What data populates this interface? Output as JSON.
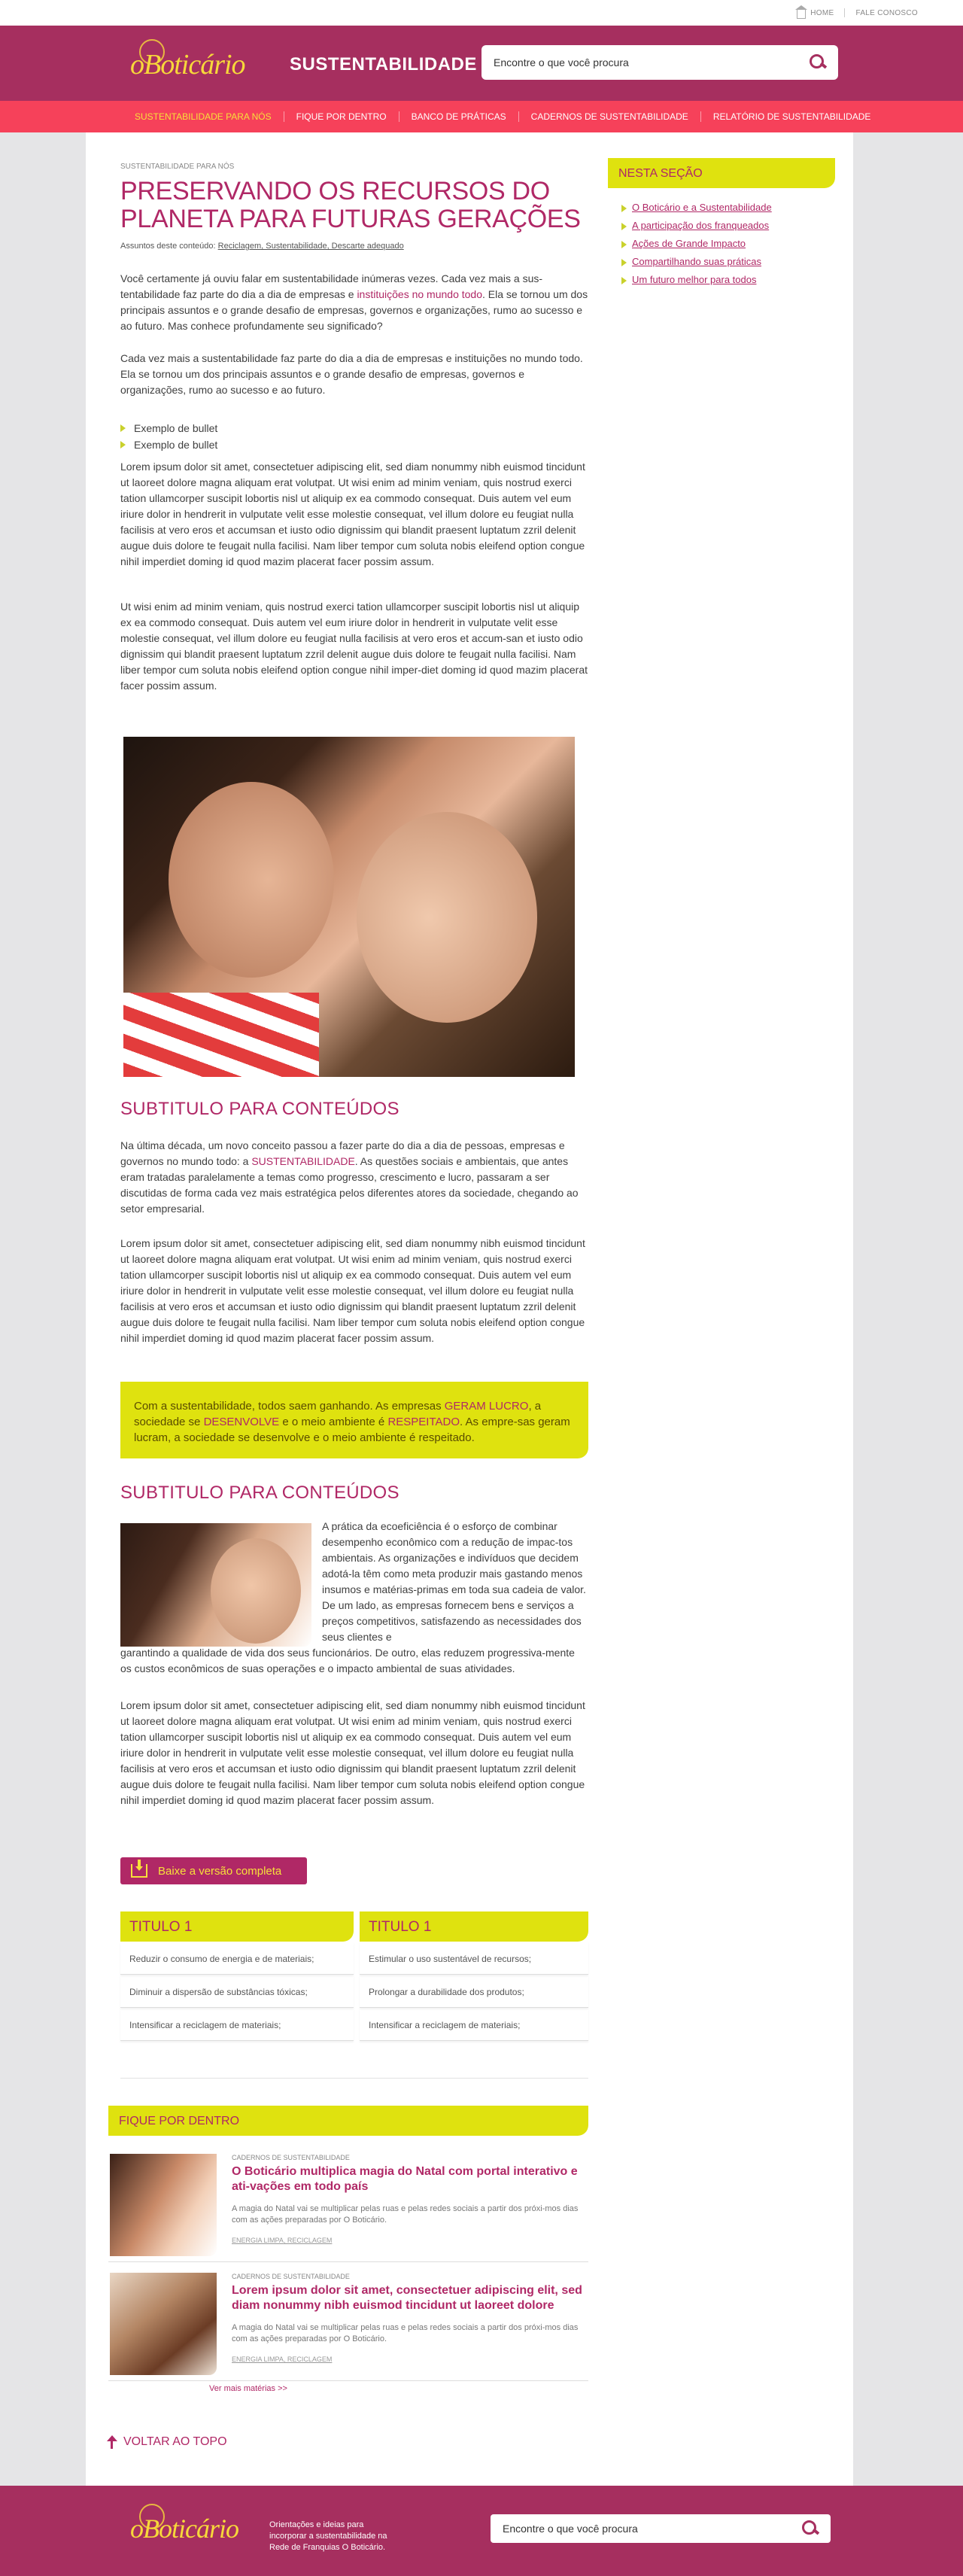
{
  "topbar": {
    "home": "HOME",
    "contact": "FALE CONOSCO"
  },
  "header": {
    "logo": "oBoticário",
    "section": "SUSTENTABILIDADE",
    "search_placeholder": "Encontre o que você procura"
  },
  "nav": [
    "SUSTENTABILIDADE PARA NÓS",
    "FIQUE POR DENTRO",
    "BANCO DE PRÁTICAS",
    "CADERNOS DE SUSTENTABILIDADE",
    "RELATÓRIO DE SUSTENTABILIDADE"
  ],
  "article": {
    "crumb": "SUSTENTABILIDADE PARA NÓS",
    "title": "PRESERVANDO OS RECURSOS DO PLANETA PARA FUTURAS GERAÇÕES",
    "topics_label": "Assuntos deste conteúdo:",
    "topics": "Reciclagem, Sustentabilidade, Descarte adequado",
    "p1_a": "Você certamente já ouviu falar em sustentabilidade inúmeras vezes. Cada vez mais a sus-tentabilidade faz parte do dia a dia de empresas e ",
    "p1_link": "instituições no mundo todo",
    "p1_b": ". Ela se tornou um dos principais assuntos e o grande desafio de empresas, governos e organizações, rumo ao sucesso e ao futuro. Mas conhece profundamente seu significado?",
    "p2": "Cada vez mais a sustentabilidade faz parte do dia a dia de empresas e instituições no mundo todo. Ela se tornou um dos principais assuntos e o grande desafio de empresas, governos e organizações, rumo ao sucesso e ao futuro.",
    "bullets": [
      "Exemplo de bullet",
      "Exemplo de bullet"
    ],
    "p3": "Lorem ipsum dolor sit amet, consectetuer adipiscing elit, sed diam nonummy nibh euismod tincidunt ut laoreet dolore magna aliquam erat volutpat. Ut wisi enim ad minim veniam, quis nostrud exerci tation ullamcorper suscipit lobortis nisl ut aliquip ex ea commodo consequat. Duis autem vel eum iriure dolor in hendrerit in vulputate velit esse molestie consequat, vel illum dolore eu feugiat nulla facilisis at vero eros et accumsan et iusto odio dignissim qui blandit praesent luptatum zzril delenit augue duis dolore te feugait nulla facilisi. Nam liber tempor cum soluta nobis eleifend option congue nihil imperdiet doming id quod mazim placerat facer possim assum.",
    "p4": "Ut wisi enim ad minim veniam, quis nostrud exerci tation ullamcorper suscipit lobortis nisl ut aliquip ex ea commodo consequat. Duis autem vel eum iriure dolor in hendrerit in vulputate velit esse molestie consequat, vel illum dolore eu feugiat nulla facilisis at vero eros et accum-san et iusto odio dignissim qui blandit praesent luptatum zzril delenit augue duis dolore te feugait nulla facilisi. Nam liber tempor cum soluta nobis eleifend option congue nihil imper-diet doming id quod mazim placerat facer possim assum.",
    "h2a": "SUBTITULO PARA CONTEÚDOS",
    "p5_a": "Na última década, um novo conceito passou a fazer parte do dia a dia de pessoas, empresas e governos no mundo todo: a ",
    "p5_link": "SUSTENTABILIDADE",
    "p5_b": ". As questões sociais e ambientais, que antes eram tratadas paralelamente a temas como progresso, crescimento e lucro, passaram a ser discutidas de forma cada vez mais estratégica pelos diferentes atores da sociedade, chegando ao setor empresarial.",
    "p6": "Lorem ipsum dolor sit amet, consectetuer adipiscing elit, sed diam nonummy nibh euismod tincidunt ut laoreet dolore magna aliquam erat volutpat. Ut wisi enim ad minim veniam, quis nostrud exerci tation ullamcorper suscipit lobortis nisl ut aliquip ex ea commodo consequat. Duis autem vel eum iriure dolor in hendrerit in vulputate velit esse molestie consequat, vel illum dolore eu feugiat nulla facilisis at vero eros et accumsan et iusto odio dignissim qui blandit praesent luptatum zzril delenit augue duis dolore te feugait nulla facilisi. Nam liber tempor cum soluta nobis eleifend option congue nihil imperdiet doming id quod mazim placerat facer possim assum.",
    "hl_1": "Com a sustentabilidade, todos saem ganhando. As empresas ",
    "hl_2": "GERAM LUCRO",
    "hl_3": ", a sociedade se ",
    "hl_4": "DESENVOLVE",
    "hl_5": " e o meio ambiente é ",
    "hl_6": "RESPEITADO",
    "hl_7": ". As empre-sas geram lucram, a sociedade se desenvolve e o meio ambiente é respeitado.",
    "h2b": "SUBTITULO PARA CONTEÚDOS",
    "p7_a": "A prática da ecoeficiência é o esforço de combinar desempenho econômico com a redução de impac-tos ambientais. As organizações e indivíduos que decidem adotá-la têm como meta produzir mais gastando menos insumos e matérias-primas em toda sua cadeia de valor. De um lado, as empresas fornecem bens e serviços a preços competitivos, satisfazendo as necessidades dos seus clientes e",
    "p7_b": "garantindo a qualidade de vida dos seus funcionários. De outro, elas reduzem progressiva-mente os custos econômicos de suas operações e o impacto ambiental de suas atividades.",
    "p8": "Lorem ipsum dolor sit amet, consectetuer adipiscing elit, sed diam nonummy nibh euismod tincidunt ut laoreet dolore magna aliquam erat volutpat. Ut wisi enim ad minim veniam, quis nostrud exerci tation ullamcorper suscipit lobortis nisl ut aliquip ex ea commodo consequat. Duis autem vel eum iriure dolor in hendrerit in vulputate velit esse molestie consequat, vel illum dolore eu feugiat nulla facilisis at vero eros et accumsan et iusto odio dignissim qui blandit praesent luptatum zzril delenit augue duis dolore te feugait nulla facilisi. Nam liber tempor cum soluta nobis eleifend option congue nihil imperdiet doming id quod mazim placerat facer possim assum.",
    "download": "Baixe a versão completa"
  },
  "tables": [
    {
      "title": "TITULO 1",
      "rows": [
        "Reduzir o consumo de energia e de materiais;",
        "Diminuir a dispersão de substâncias tóxicas;",
        "Intensificar a reciclagem de materiais;"
      ]
    },
    {
      "title": "TITULO 1",
      "rows": [
        "Estimular o uso sustentável de recursos;",
        "Prolongar a durabilidade dos produtos;",
        "Intensificar a reciclagem de materiais;"
      ]
    }
  ],
  "sidebar": {
    "title": "NESTA SEÇÃO",
    "items": [
      "O Boticário e a Sustentabilidade",
      "A participação dos franqueados",
      "Ações de Grande Impacto",
      "Compartilhando suas práticas",
      "Um futuro melhor para todos"
    ]
  },
  "fique": {
    "title": "FIQUE POR DENTRO",
    "news": [
      {
        "cat": "CADERNOS DE SUSTENTABILIDADE",
        "title": "O Boticário multiplica magia do Natal com portal interativo e ati-vações em todo país",
        "desc": "A magia do Natal vai se multiplicar pelas ruas e pelas redes sociais a partir dos próxi-mos dias com as ações preparadas por O Boticário.",
        "tags": "ENERGIA LIMPA, RECICLAGEM"
      },
      {
        "cat": "CADERNOS DE SUSTENTABILIDADE",
        "title": "Lorem ipsum dolor sit amet, consectetuer adipiscing elit, sed diam nonummy nibh euismod tincidunt ut laoreet dolore",
        "desc": "A magia do Natal vai se multiplicar pelas ruas e pelas redes sociais a partir dos próxi-mos dias com as ações preparadas por O Boticário.",
        "tags": "ENERGIA LIMPA, RECICLAGEM"
      }
    ],
    "more": "Ver mais matérias >>"
  },
  "back_to_top": "VOLTAR AO TOPO",
  "footer": {
    "logo": "oBoticário",
    "tagline": "Orientações e ideias para incorporar a sustentabilidade na Rede de Franquias O Boticário.",
    "search_placeholder": "Encontre o que você procura"
  },
  "colors": {
    "brand": "#a62f5f",
    "accent_pink": "#b02866",
    "nav_red": "#f6415a",
    "yellow": "#dfe20f"
  }
}
